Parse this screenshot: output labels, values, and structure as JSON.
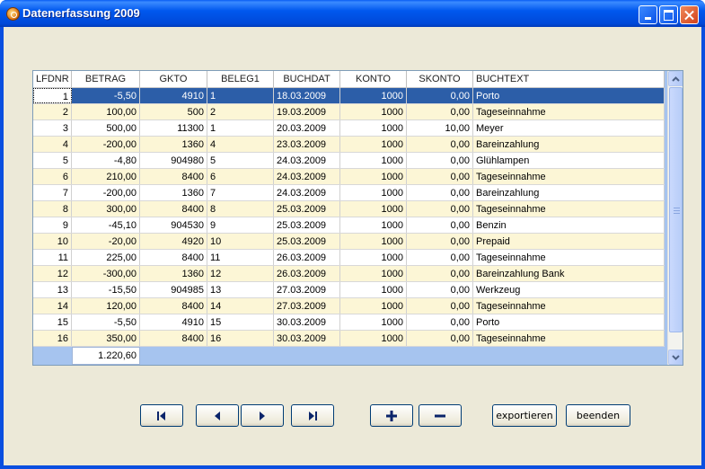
{
  "window": {
    "title": "Datenerfassung 2009"
  },
  "grid": {
    "columns": [
      "LFDNR",
      "BETRAG",
      "GKTO",
      "BELEG1",
      "BUCHDAT",
      "KONTO",
      "SKONTO",
      "BUCHTEXT"
    ],
    "rows": [
      {
        "lfdnr": "1",
        "betrag": "-5,50",
        "gkto": "4910",
        "beleg": "1",
        "buchdat": "18.03.2009",
        "konto": "1000",
        "skonto": "0,00",
        "buchtext": "Porto"
      },
      {
        "lfdnr": "2",
        "betrag": "100,00",
        "gkto": "500",
        "beleg": "2",
        "buchdat": "19.03.2009",
        "konto": "1000",
        "skonto": "0,00",
        "buchtext": "Tageseinnahme"
      },
      {
        "lfdnr": "3",
        "betrag": "500,00",
        "gkto": "11300",
        "beleg": "1",
        "buchdat": "20.03.2009",
        "konto": "1000",
        "skonto": "10,00",
        "buchtext": "Meyer"
      },
      {
        "lfdnr": "4",
        "betrag": "-200,00",
        "gkto": "1360",
        "beleg": "4",
        "buchdat": "23.03.2009",
        "konto": "1000",
        "skonto": "0,00",
        "buchtext": "Bareinzahlung"
      },
      {
        "lfdnr": "5",
        "betrag": "-4,80",
        "gkto": "904980",
        "beleg": "5",
        "buchdat": "24.03.2009",
        "konto": "1000",
        "skonto": "0,00",
        "buchtext": "Glühlampen"
      },
      {
        "lfdnr": "6",
        "betrag": "210,00",
        "gkto": "8400",
        "beleg": "6",
        "buchdat": "24.03.2009",
        "konto": "1000",
        "skonto": "0,00",
        "buchtext": "Tageseinnahme"
      },
      {
        "lfdnr": "7",
        "betrag": "-200,00",
        "gkto": "1360",
        "beleg": "7",
        "buchdat": "24.03.2009",
        "konto": "1000",
        "skonto": "0,00",
        "buchtext": "Bareinzahlung"
      },
      {
        "lfdnr": "8",
        "betrag": "300,00",
        "gkto": "8400",
        "beleg": "8",
        "buchdat": "25.03.2009",
        "konto": "1000",
        "skonto": "0,00",
        "buchtext": "Tageseinnahme"
      },
      {
        "lfdnr": "9",
        "betrag": "-45,10",
        "gkto": "904530",
        "beleg": "9",
        "buchdat": "25.03.2009",
        "konto": "1000",
        "skonto": "0,00",
        "buchtext": "Benzin"
      },
      {
        "lfdnr": "10",
        "betrag": "-20,00",
        "gkto": "4920",
        "beleg": "10",
        "buchdat": "25.03.2009",
        "konto": "1000",
        "skonto": "0,00",
        "buchtext": "Prepaid"
      },
      {
        "lfdnr": "11",
        "betrag": "225,00",
        "gkto": "8400",
        "beleg": "11",
        "buchdat": "26.03.2009",
        "konto": "1000",
        "skonto": "0,00",
        "buchtext": "Tageseinnahme"
      },
      {
        "lfdnr": "12",
        "betrag": "-300,00",
        "gkto": "1360",
        "beleg": "12",
        "buchdat": "26.03.2009",
        "konto": "1000",
        "skonto": "0,00",
        "buchtext": "Bareinzahlung Bank"
      },
      {
        "lfdnr": "13",
        "betrag": "-15,50",
        "gkto": "904985",
        "beleg": "13",
        "buchdat": "27.03.2009",
        "konto": "1000",
        "skonto": "0,00",
        "buchtext": "Werkzeug"
      },
      {
        "lfdnr": "14",
        "betrag": "120,00",
        "gkto": "8400",
        "beleg": "14",
        "buchdat": "27.03.2009",
        "konto": "1000",
        "skonto": "0,00",
        "buchtext": "Tageseinnahme"
      },
      {
        "lfdnr": "15",
        "betrag": "-5,50",
        "gkto": "4910",
        "beleg": "15",
        "buchdat": "30.03.2009",
        "konto": "1000",
        "skonto": "0,00",
        "buchtext": "Porto"
      },
      {
        "lfdnr": "16",
        "betrag": "350,00",
        "gkto": "8400",
        "beleg": "16",
        "buchdat": "30.03.2009",
        "konto": "1000",
        "skonto": "0,00",
        "buchtext": "Tageseinnahme"
      }
    ],
    "selected_row": 0,
    "sum_betrag": "1.220,60"
  },
  "buttons": {
    "first_icon": "first-record-icon",
    "prev_icon": "previous-record-icon",
    "next_icon": "next-record-icon",
    "last_icon": "last-record-icon",
    "add_icon": "plus-icon",
    "delete_icon": "minus-icon",
    "export_label": "exportieren",
    "quit_label": "beenden"
  }
}
